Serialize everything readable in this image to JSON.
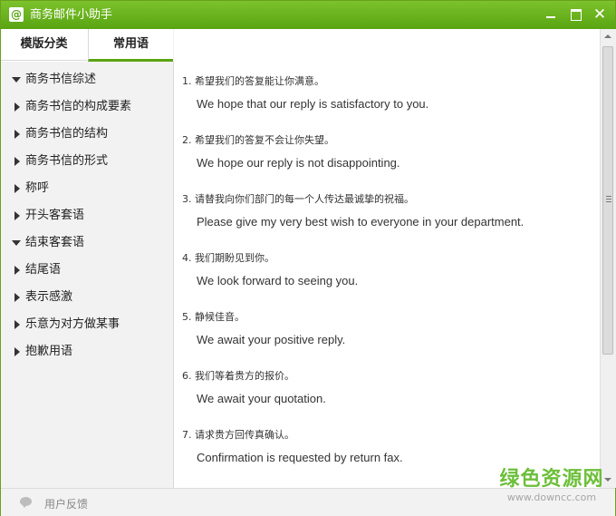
{
  "window": {
    "title": "商务邮件小助手",
    "icon_text": "@",
    "close_glyph": "✕"
  },
  "tabs": [
    {
      "label": "模版分类"
    },
    {
      "label": "常用语"
    }
  ],
  "sidebar": {
    "items": [
      {
        "label": "商务书信综述",
        "expanded": true
      },
      {
        "label": "商务书信的构成要素",
        "expanded": false
      },
      {
        "label": "商务书信的结构",
        "expanded": false
      },
      {
        "label": "商务书信的形式",
        "expanded": false
      },
      {
        "label": "称呼",
        "expanded": false
      },
      {
        "label": "开头客套语",
        "expanded": false
      },
      {
        "label": "结束客套语",
        "expanded": true
      },
      {
        "label": "结尾语",
        "expanded": false
      },
      {
        "label": "表示感激",
        "expanded": false
      },
      {
        "label": "乐意为对方做某事",
        "expanded": false
      },
      {
        "label": "抱歉用语",
        "expanded": false
      }
    ]
  },
  "phrases": [
    {
      "zh": "1. 希望我们的答复能让你满意。",
      "en": "We hope that our reply is satisfactory to you."
    },
    {
      "zh": "2. 希望我们的答复不会让你失望。",
      "en": "We hope our reply is not disappointing."
    },
    {
      "zh": "3. 请替我向你们部门的每一个人传达最诚挚的祝福。",
      "en": "Please give my very best wish to everyone in your department."
    },
    {
      "zh": "4. 我们期盼见到你。",
      "en": "We look forward to seeing you."
    },
    {
      "zh": "5. 静候佳音。",
      "en": "We await your positive reply."
    },
    {
      "zh": "6. 我们等着贵方的报价。",
      "en": "We await your quotation."
    },
    {
      "zh": "7. 请求贵方回传真确认。",
      "en": "Confirmation is requested by return fax."
    }
  ],
  "statusbar": {
    "feedback_label": "用户反馈"
  },
  "watermark": {
    "cn": "绿色资源网",
    "url": "www.downcc.com"
  },
  "colors": {
    "accent": "#5aa412",
    "titlebar": "#6cb51f",
    "watermark": "#6cbf3a"
  }
}
